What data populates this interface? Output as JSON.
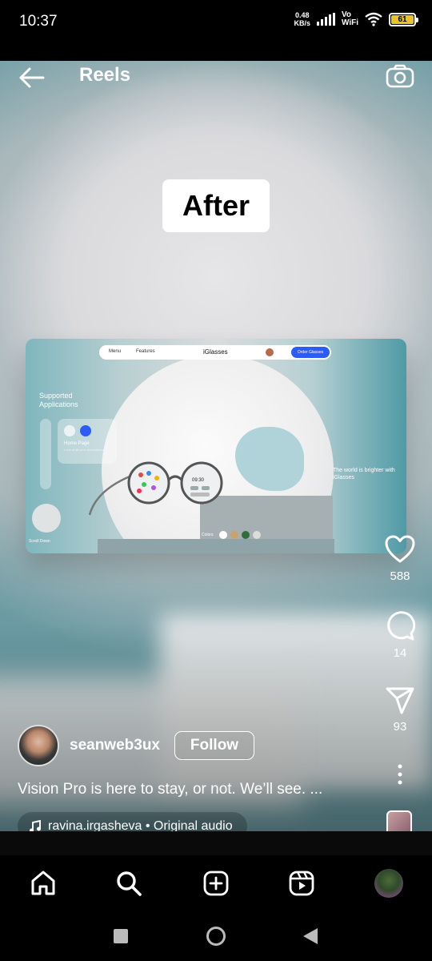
{
  "status": {
    "time": "10:37",
    "speed_value": "0.48",
    "speed_unit": "KB/s",
    "vo": "Vo",
    "wifi": "WiFi",
    "battery": "61"
  },
  "topbar": {
    "title": "Reels"
  },
  "reel": {
    "overlay_text": "After",
    "mockup": {
      "nav_menu": "Menu",
      "nav_features": "Features",
      "brand": "iGlasses",
      "order_button": "Order Glasses",
      "supported": "Supported Applications",
      "home_page": "Home Page",
      "home_sub": "Look at all your applications",
      "world_text": "The world is brighter with iGlasses",
      "scroll_down": "Scroll Down",
      "colors_label": "Colors",
      "clock": "09:30"
    }
  },
  "actions": {
    "likes": "588",
    "comments": "14",
    "shares": "93"
  },
  "author": {
    "username": "seanweb3ux",
    "follow_label": "Follow"
  },
  "caption": "Vision Pro is here to stay, or not. We’ll see. ...",
  "audio": {
    "label": "ravina.irgasheva • Original audio"
  },
  "colors": {
    "accent": "#2b5cf6",
    "battery": "#e7c32c"
  }
}
